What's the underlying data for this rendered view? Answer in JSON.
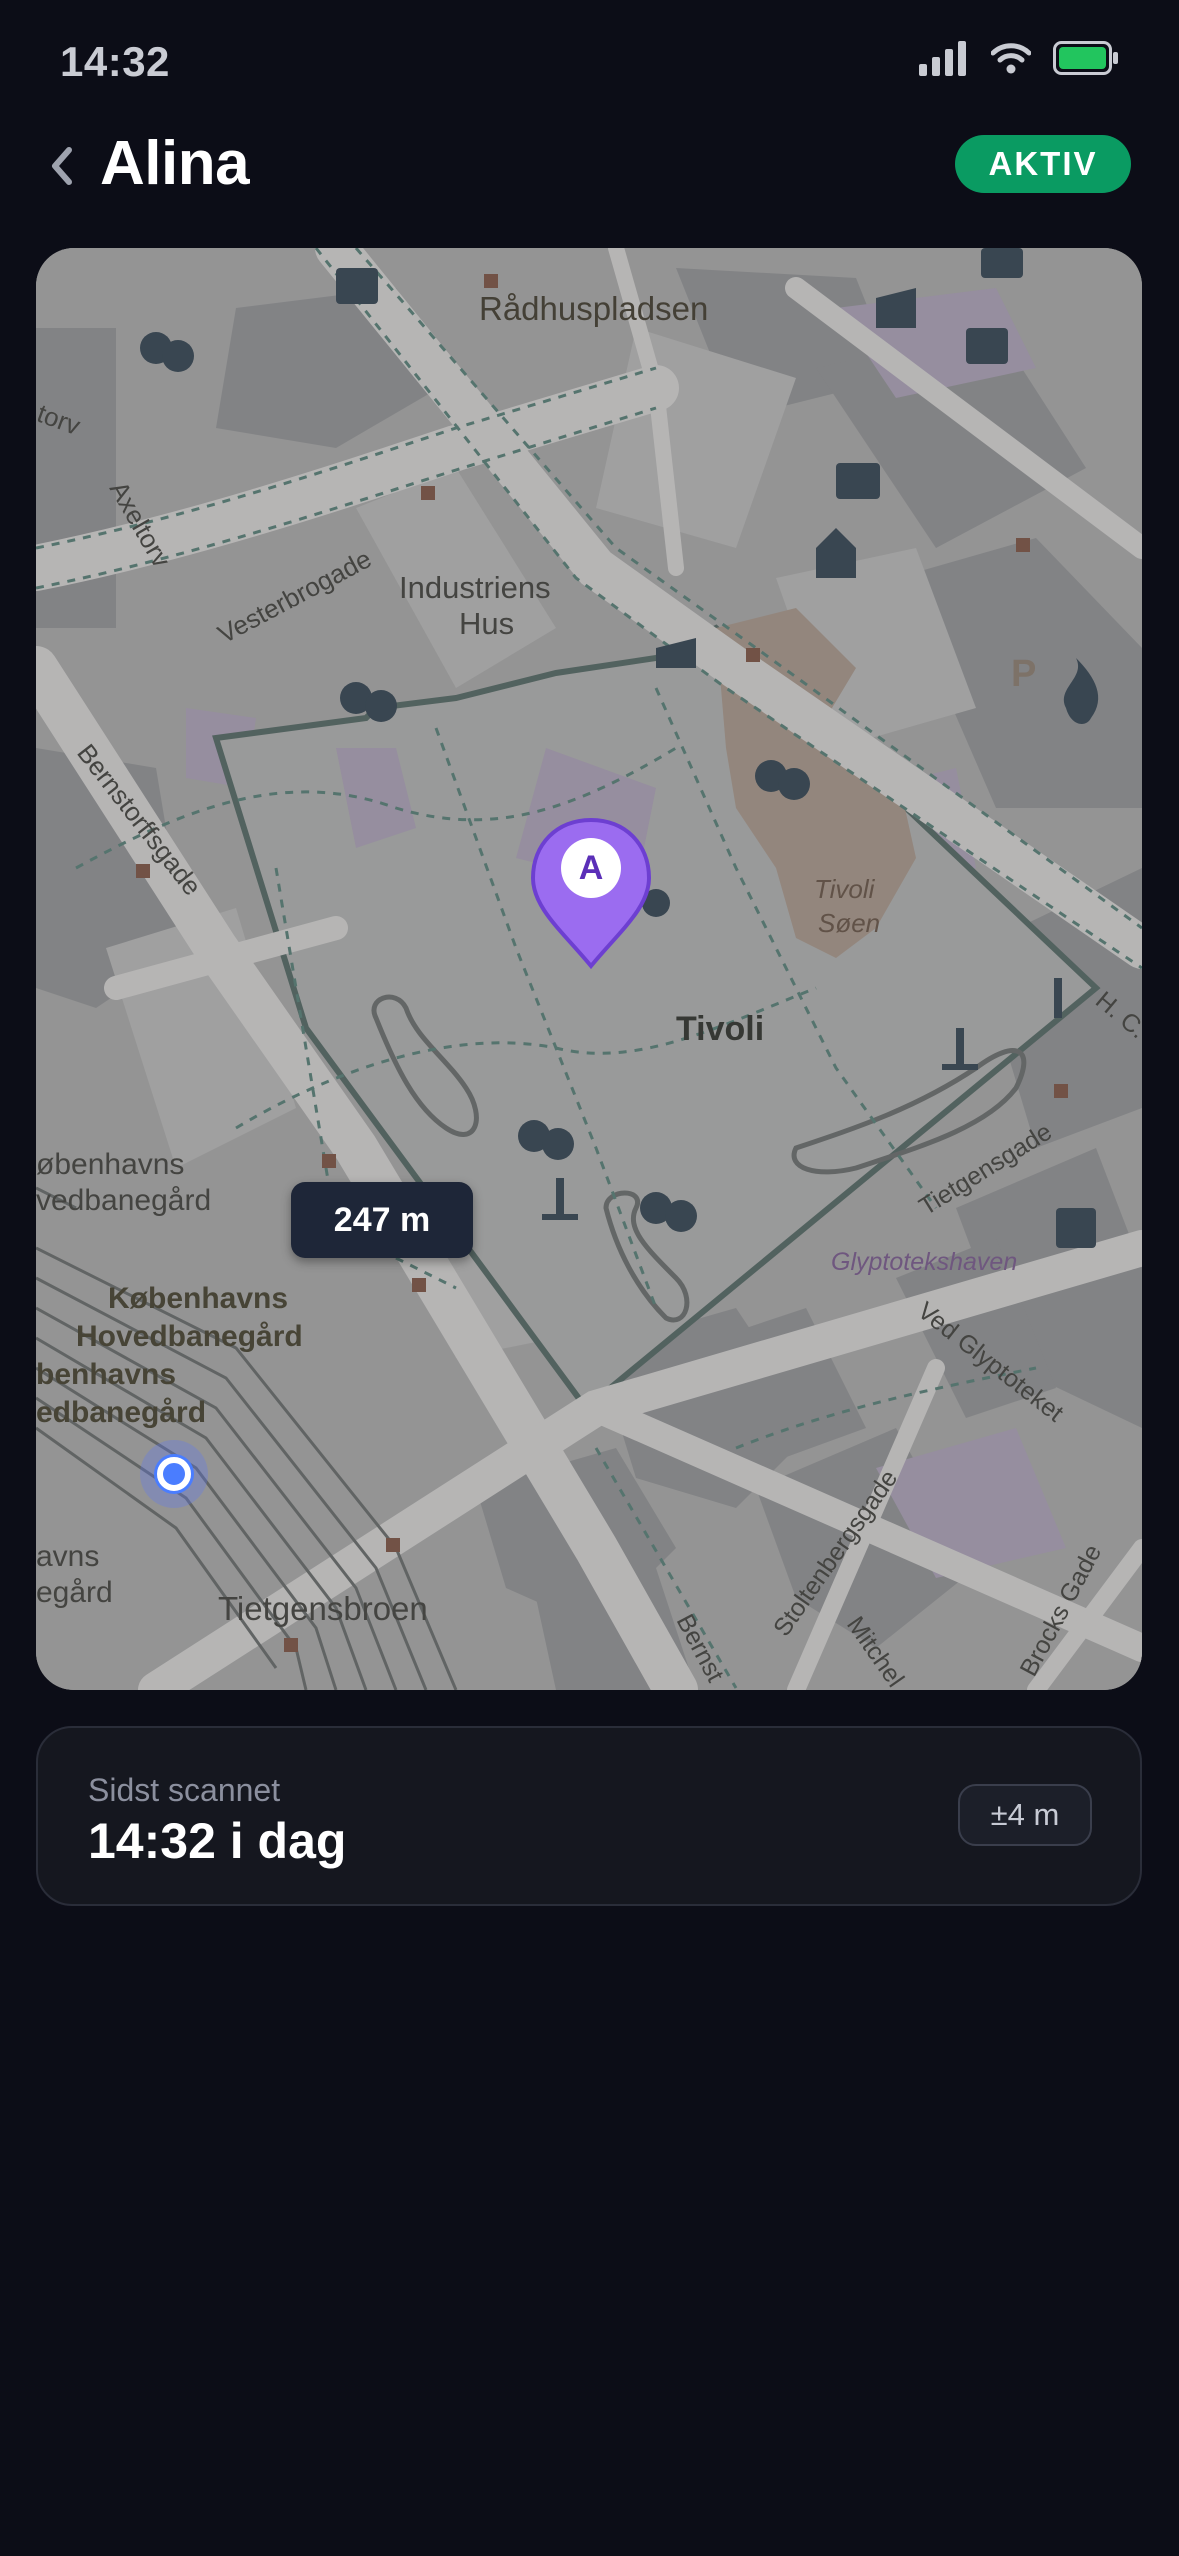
{
  "status_bar": {
    "time": "14:32",
    "icons": [
      "signal-icon",
      "wifi-icon",
      "battery-icon"
    ],
    "battery_color": "#22c55e"
  },
  "header": {
    "back_icon": "chevron-left-icon",
    "title": "Alina",
    "status_badge": "AKTIV",
    "status_color": "#0a9b62"
  },
  "map": {
    "labels": {
      "radhuspladsen": "Rådhuspladsen",
      "industriens_line1": "Industriens",
      "industriens_line2": "Hus",
      "vesterbrogade": "Vesterbrogade",
      "axeltorv": "Axeltorv",
      "torv": "torv",
      "bernstorffsgade": "Bernstorffsgade",
      "tivoli": "Tivoli",
      "tivoli_soen_line1": "Tivoli",
      "tivoli_soen_line2": "Søen",
      "station_small_line1": "øbenhavns",
      "station_small_line2": "vedbanegård",
      "station_bold_line1": "Københavns",
      "station_bold_line2": "Hovedbanegård",
      "station_bold_line3": "benhavns",
      "station_bold_line4": "edbanegård",
      "station_left_line1": "avns",
      "station_left_line2": "egård",
      "tietgensbroen": "Tietgensbroen",
      "tietgensgade": "Tietgensgade",
      "glyptotekshaven": "Glyptotekshaven",
      "ved_glyptoteket": "Ved Glyptoteket",
      "stoltenbergsgade": "Stoltenbergsgade",
      "brocks_gade": "Brocks Gade",
      "mitchell": "Mitchel",
      "bernst": "Bernst",
      "hc": "H. C.",
      "parking": "P"
    },
    "pin": {
      "letter": "A",
      "color": "#9b6cf0"
    },
    "distance": "247 m",
    "user_location_color": "#4a7dff"
  },
  "info": {
    "label": "Sidst scannet",
    "value": "14:32 i dag",
    "accuracy": "±4 m"
  }
}
